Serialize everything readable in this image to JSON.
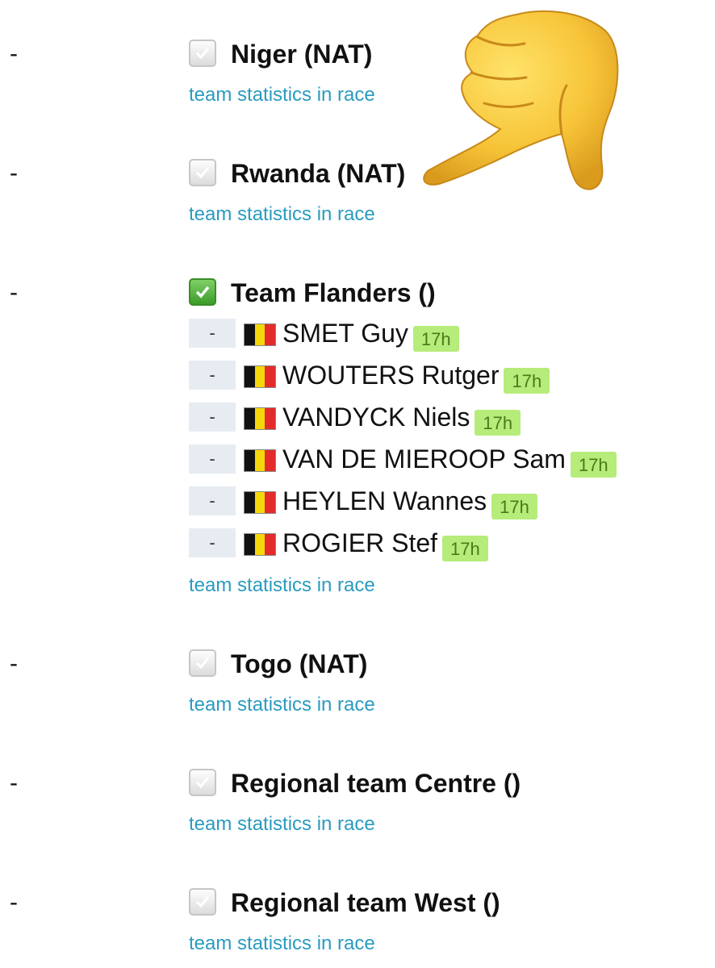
{
  "teams": [
    {
      "bullet": "-",
      "name": "Niger (NAT)",
      "selected": false,
      "link": "team statistics in race"
    },
    {
      "bullet": "-",
      "name": "Rwanda (NAT)",
      "selected": false,
      "link": "team statistics in race"
    },
    {
      "bullet": "-",
      "name": "Team Flanders ()",
      "selected": true,
      "link": "team statistics in race",
      "riders": [
        {
          "cell": "-",
          "name": "SMET Guy",
          "badge": "17h"
        },
        {
          "cell": "-",
          "name": "WOUTERS Rutger",
          "badge": "17h"
        },
        {
          "cell": "-",
          "name": "VANDYCK Niels",
          "badge": "17h"
        },
        {
          "cell": "-",
          "name": "VAN DE MIEROOP Sam",
          "badge": "17h"
        },
        {
          "cell": "-",
          "name": "HEYLEN Wannes",
          "badge": "17h"
        },
        {
          "cell": "-",
          "name": "ROGIER Stef",
          "badge": "17h"
        }
      ]
    },
    {
      "bullet": "-",
      "name": "Togo (NAT)",
      "selected": false,
      "link": "team statistics in race"
    },
    {
      "bullet": "-",
      "name": "Regional team Centre ()",
      "selected": false,
      "link": "team statistics in race"
    },
    {
      "bullet": "-",
      "name": "Regional team West ()",
      "selected": false,
      "link": "team statistics in race"
    }
  ],
  "icons": {
    "checkbox": "check-icon",
    "flag": "belgium-flag-icon",
    "overlay": "thumbs-down-emoji-icon"
  },
  "colors": {
    "link": "#2a9bbf",
    "badge_bg": "#b6ec7a",
    "badge_text": "#4b7a1a",
    "checked": "#4caf3a",
    "flag": [
      "#111111",
      "#f5d60b",
      "#e32b2b"
    ]
  }
}
